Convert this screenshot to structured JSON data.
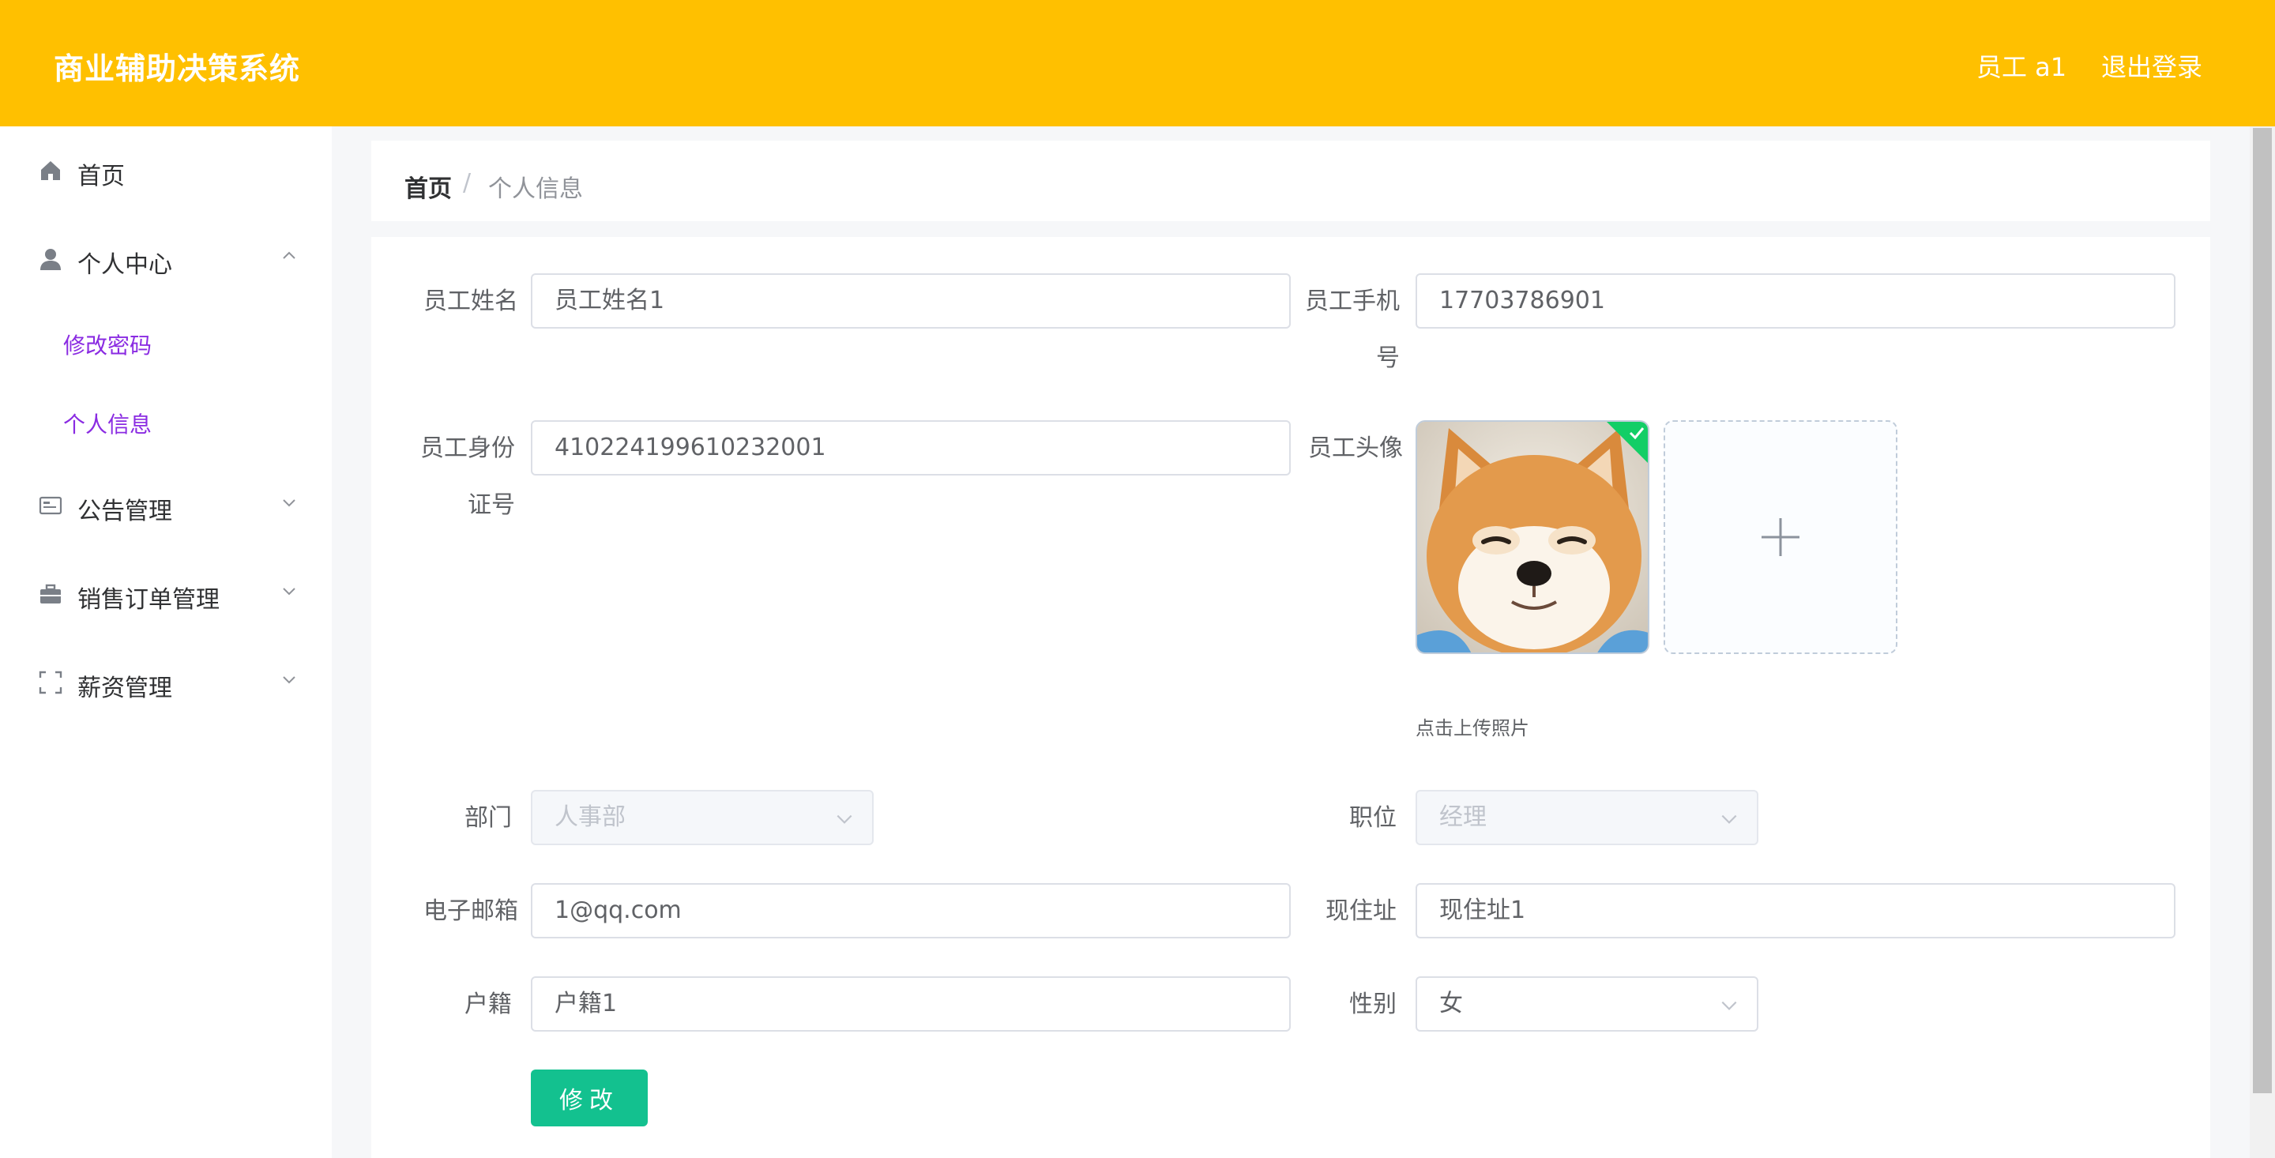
{
  "header": {
    "app_title": "商业辅助决策系统",
    "user_label": "员工 a1",
    "logout_label": "退出登录",
    "bg_color": "#ffc000"
  },
  "sidebar": {
    "items": [
      {
        "label": "首页",
        "icon": "home-icon"
      },
      {
        "label": "个人中心",
        "icon": "user-icon",
        "expanded": true,
        "children": [
          {
            "label": "修改密码"
          },
          {
            "label": "个人信息"
          }
        ]
      },
      {
        "label": "公告管理",
        "icon": "notice-icon"
      },
      {
        "label": "销售订单管理",
        "icon": "briefcase-icon"
      },
      {
        "label": "薪资管理",
        "icon": "frame-icon"
      }
    ],
    "submenu_color": "#8a2be2"
  },
  "breadcrumb": {
    "home": "首页",
    "separator": "/",
    "current": "个人信息"
  },
  "form": {
    "name_label": "员工姓名",
    "name_value": "员工姓名1",
    "phone_label": "员工手机号",
    "phone_value": "17703786901",
    "idcard_label": "员工身份证号",
    "idcard_value": "410224199610232001",
    "avatar_label": "员工头像",
    "upload_hint": "点击上传照片",
    "department_label": "部门",
    "department_value": "人事部",
    "position_label": "职位",
    "position_value": "经理",
    "email_label": "电子邮箱",
    "email_value": "1@qq.com",
    "address_label": "现住址",
    "address_value": "现住址1",
    "hukou_label": "户籍",
    "hukou_value": "户籍1",
    "gender_label": "性别",
    "gender_value": "女",
    "submit_label": "修改",
    "submit_color": "#13c18f"
  }
}
